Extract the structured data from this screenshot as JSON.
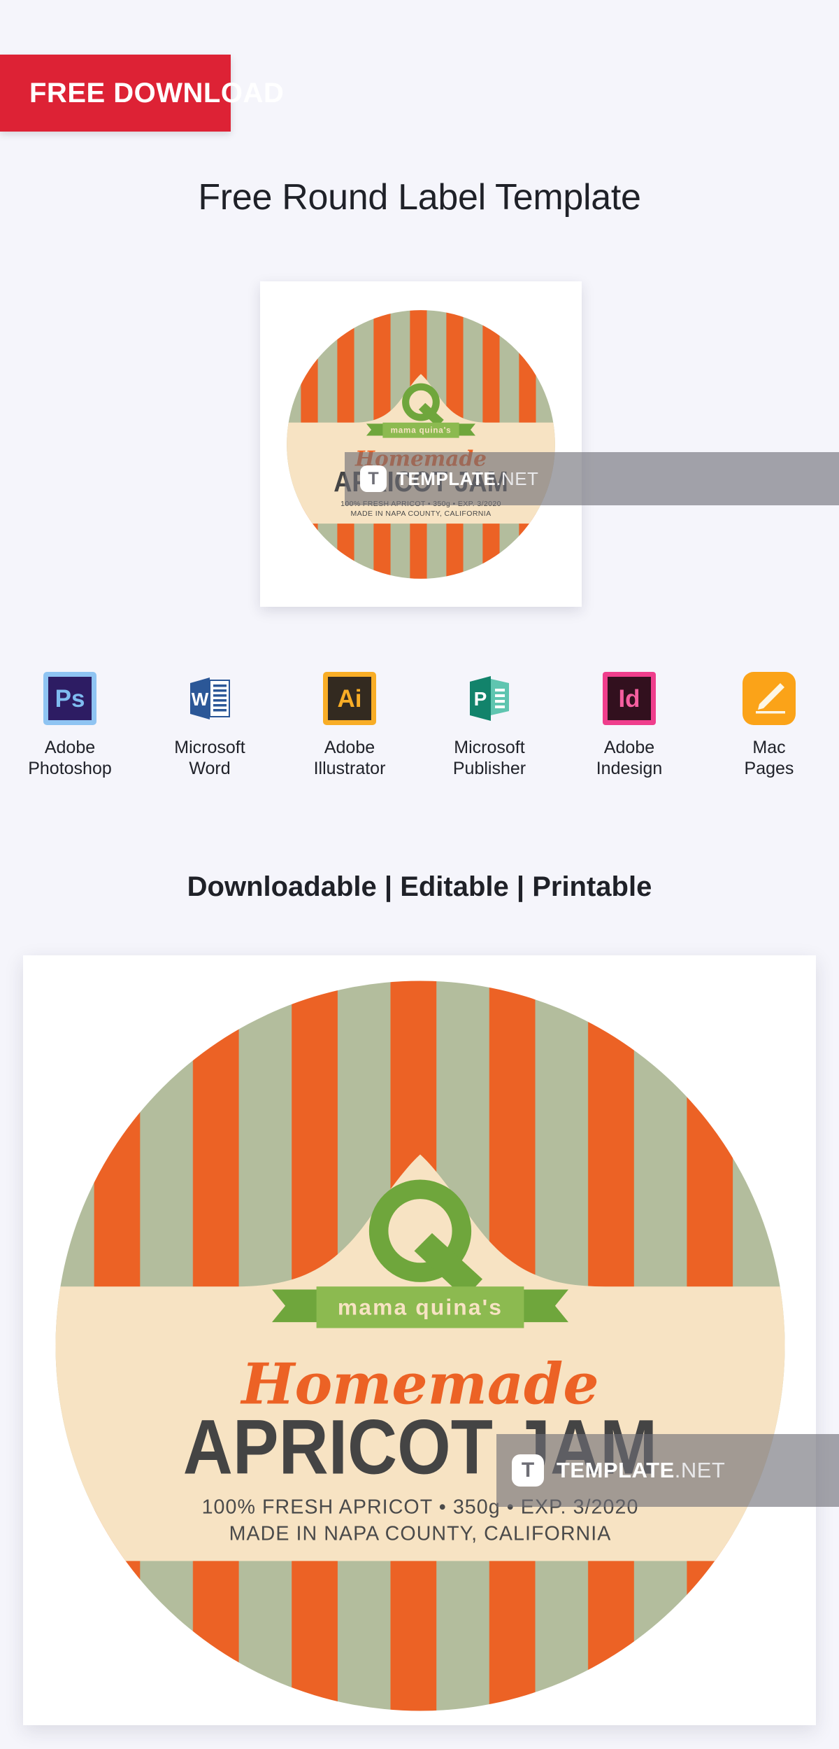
{
  "badge": {
    "label": "FREE DOWNLOAD",
    "color": "#dd2235",
    "text_color": "#ffffff"
  },
  "page_title": "Free Round Label Template",
  "features_line": "Downloadable | Editable | Printable",
  "apps": [
    {
      "icon": "photoshop-icon",
      "glyph": "Ps",
      "label": "Adobe\nPhotoshop",
      "color": "#2d1c63"
    },
    {
      "icon": "word-icon",
      "glyph": "W",
      "label": "Microsoft\nWord",
      "color": "#2b5797"
    },
    {
      "icon": "illustrator-icon",
      "glyph": "Ai",
      "label": "Adobe\nIllustrator",
      "color": "#f8ad26"
    },
    {
      "icon": "publisher-icon",
      "glyph": "P",
      "label": "Microsoft\nPublisher",
      "color": "#12836b"
    },
    {
      "icon": "indesign-icon",
      "glyph": "Id",
      "label": "Adobe\nIndesign",
      "color": "#ef3e8c"
    },
    {
      "icon": "pages-icon",
      "glyph": "pen",
      "label": "Mac\nPages",
      "color": "#fba318"
    }
  ],
  "label_design": {
    "brand_mark": "Q",
    "ribbon_text": "mama quina's",
    "script_line": "Homemade",
    "product_name": "APRICOT JAM",
    "detail_line_1": "100% FRESH APRICOT  •  350g  •  EXP. 3/2020",
    "detail_line_2": "MADE IN NAPA COUNTY, CALIFORNIA",
    "colors": {
      "orange": "#ec6225",
      "sage": "#b3bd9d",
      "cream": "#f7e3c3",
      "green": "#6fa63c",
      "charcoal": "#444444"
    },
    "stripe_count": 15
  },
  "watermark": {
    "brand_bold": "TEMPLATE",
    "brand_light": ".NET",
    "logo_glyph": "T"
  }
}
